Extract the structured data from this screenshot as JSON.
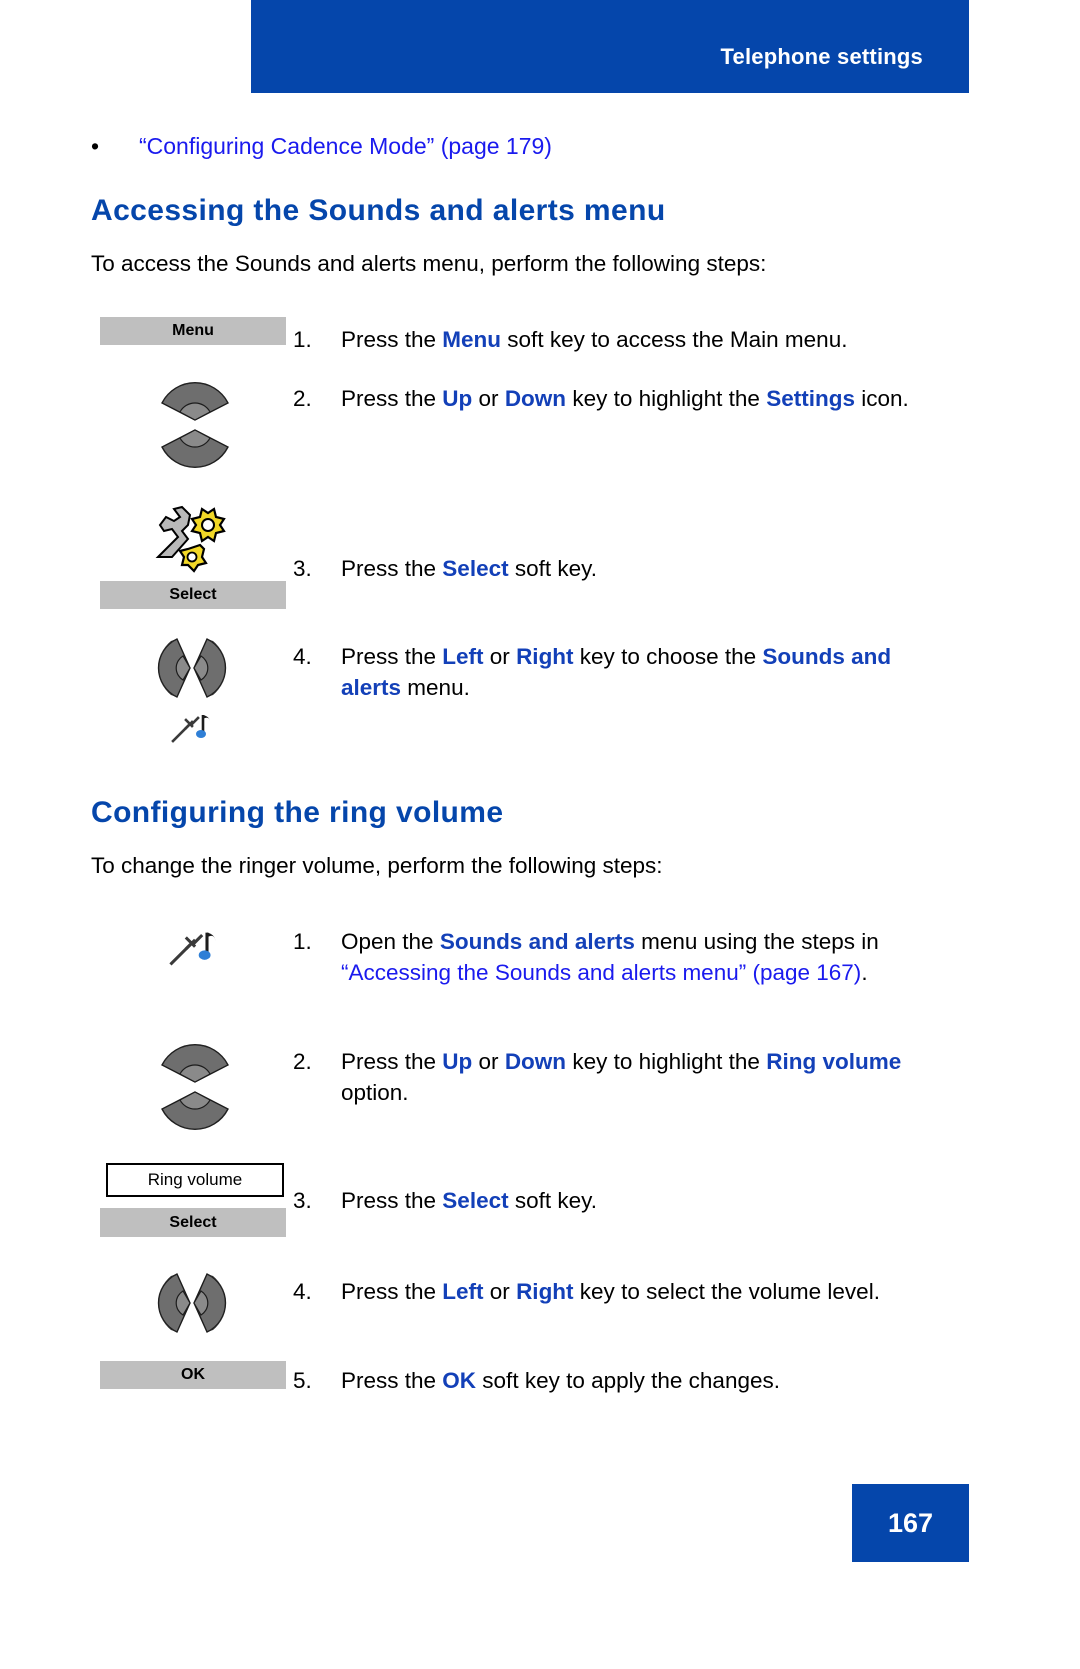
{
  "header": {
    "title": "Telephone settings"
  },
  "bullet": {
    "marker": "•",
    "text": "“Configuring Cadence Mode” (page 179)"
  },
  "sections": [
    {
      "heading": "Accessing the Sounds and alerts menu",
      "lead": "To access the Sounds and alerts menu, perform the following steps:",
      "steps": [
        {
          "num": "1.",
          "text_html": "Press the <b>Menu</b> soft key to access the Main menu."
        },
        {
          "num": "2.",
          "text_html": "Press the <b>Up</b> or <b>Down</b> key to highlight the <b>Settings</b> icon."
        },
        {
          "num": "3.",
          "text_html": "Press the <b>Select</b> soft key."
        },
        {
          "num": "4.",
          "text_html": "Press the <b>Left</b> or <b>Right</b> key to choose the <b>Sounds and alerts</b> menu."
        }
      ]
    },
    {
      "heading": "Configuring the ring volume",
      "lead": "To change the ringer volume, perform the following steps:",
      "steps": [
        {
          "num": "1.",
          "text_html": "Open the <b>Sounds and alerts</b> menu using the steps in <a>“Accessing the Sounds and alerts menu” (page 167)</a>."
        },
        {
          "num": "2.",
          "text_html": "Press the <b>Up</b> or <b>Down</b> key to highlight the <b>Ring volume</b> option."
        },
        {
          "num": "3.",
          "text_html": "Press the <b>Select</b> soft key."
        },
        {
          "num": "4.",
          "text_html": "Press the <b>Left</b> or <b>Right</b> key to select the volume level."
        },
        {
          "num": "5.",
          "text_html": "Press the <b>OK</b> soft key to apply the changes."
        }
      ]
    }
  ],
  "softkeys": {
    "menu": "Menu",
    "select_1": "Select",
    "select_2": "Select",
    "ok": "OK"
  },
  "labels": {
    "ring_volume": "Ring volume"
  },
  "icons": {
    "up_down_key": "up-down-navigation-key-icon",
    "left_right_key": "left-right-navigation-key-icon",
    "settings_gear": "settings-wrench-gear-icon",
    "sounds_alerts": "sounds-and-alerts-tuning-fork-note-icon"
  },
  "footer": {
    "page_number": "167"
  },
  "colors": {
    "brand_blue": "#0546ab",
    "link_blue": "#1a1aee",
    "bold_blue": "#1340b8",
    "softkey_gray": "#bfbfbf",
    "gear_yellow": "#f2d827"
  }
}
